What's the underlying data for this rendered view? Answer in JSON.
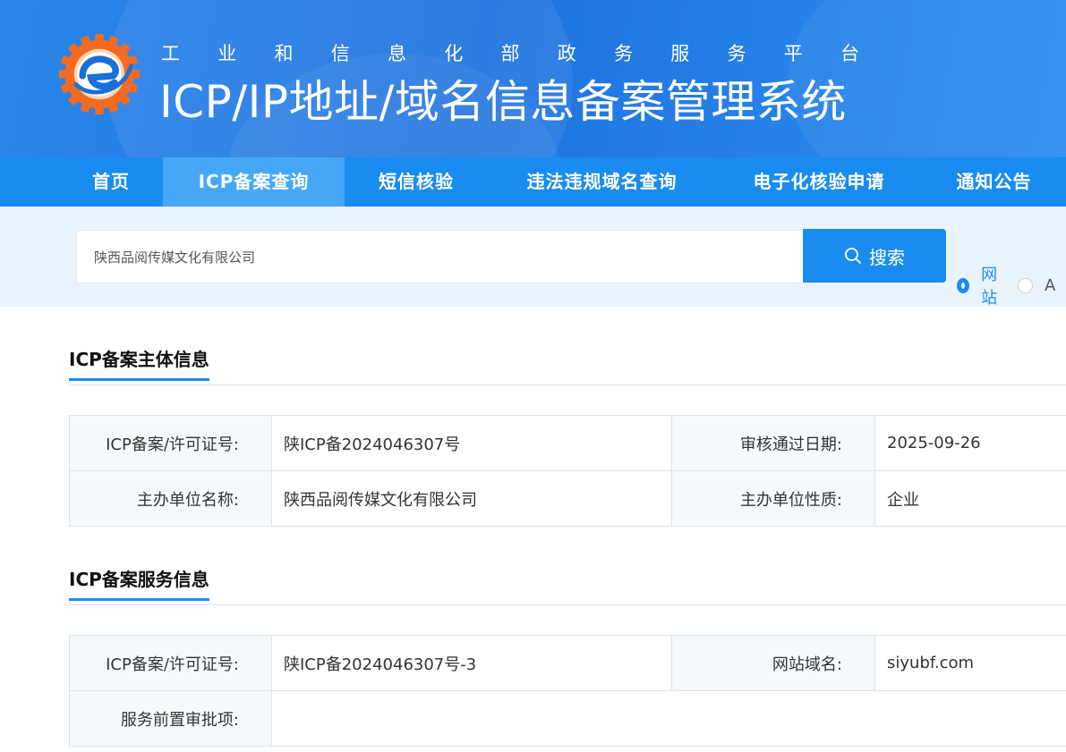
{
  "header": {
    "subtitle_chars": [
      "工",
      "业",
      "和",
      "信",
      "息",
      "化",
      "部",
      "政",
      "务",
      "服",
      "务",
      "平",
      "台"
    ],
    "title": "ICP/IP地址/域名信息备案管理系统",
    "logo_icon": "miit-gear-logo-icon"
  },
  "nav": {
    "items": [
      {
        "label": "首页",
        "active": false
      },
      {
        "label": "ICP备案查询",
        "active": true
      },
      {
        "label": "短信核验",
        "active": false
      },
      {
        "label": "违法违规域名查询",
        "active": false
      },
      {
        "label": "电子化核验申请",
        "active": false
      },
      {
        "label": "通知公告",
        "active": false
      }
    ]
  },
  "search": {
    "value": "陕西品阅传媒文化有限公司",
    "button_label": "搜索",
    "button_icon": "search-icon",
    "radios": [
      {
        "label": "网站",
        "checked": true
      },
      {
        "label": "A",
        "checked": false
      }
    ]
  },
  "subject_section": {
    "title": "ICP备案主体信息",
    "rows": [
      {
        "label1": "ICP备案/许可证号:",
        "value1": "陕ICP备2024046307号",
        "label2": "审核通过日期:",
        "value2": "2025-09-26"
      },
      {
        "label1": "主办单位名称:",
        "value1": "陕西品阅传媒文化有限公司",
        "label2": "主办单位性质:",
        "value2": "企业"
      }
    ]
  },
  "service_section": {
    "title": "ICP备案服务信息",
    "row1": {
      "label1": "ICP备案/许可证号:",
      "value1": "陕ICP备2024046307号-3",
      "label2": "网站域名:",
      "value2": "siyubf.com"
    },
    "row2": {
      "label1": "服务前置审批项:",
      "value1": ""
    }
  },
  "colors": {
    "banner": "#1f73df",
    "nav": "#1a8cf0",
    "nav_active": "#45a8f7",
    "accent": "#1a8cf0",
    "search_band": "#e9f3fc",
    "logo_orange": "#f36b21"
  }
}
